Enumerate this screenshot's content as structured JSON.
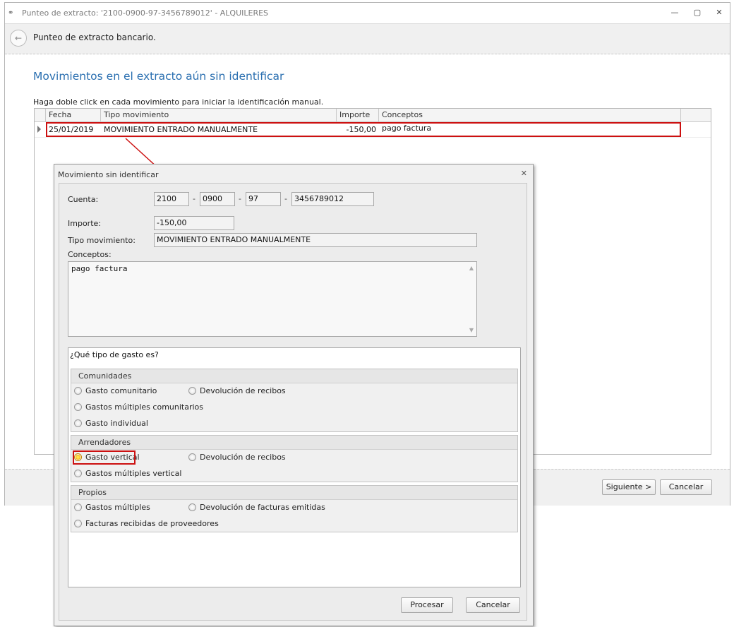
{
  "main_window": {
    "title": "Punteo de extracto: '2100-0900-97-3456789012' - ALQUILERES",
    "title_icon": "link-icon",
    "controls": {
      "minimize": "—",
      "restore": "▢",
      "close": "✕"
    },
    "header_title": "Punteo de extracto bancario.",
    "back_icon": "back-arrow-icon",
    "section_title": "Movimientos en el extracto aún sin identificar",
    "instruction": "Haga doble click en cada movimiento para iniciar la identificación manual.",
    "grid": {
      "columns": [
        "Fecha",
        "Tipo movimiento",
        "Importe",
        "Conceptos"
      ],
      "rows": [
        {
          "fecha": "25/01/2019",
          "tipo": "MOVIMIENTO ENTRADO MANUALMENTE",
          "importe": "-150,00",
          "conceptos": "pago factura"
        }
      ]
    },
    "buttons": {
      "next": "Siguiente >",
      "cancel": "Cancelar"
    }
  },
  "dialog": {
    "title": "Movimiento sin identificar",
    "close": "✕",
    "cuenta_label": "Cuenta:",
    "cuenta": [
      "2100",
      "0900",
      "97",
      "3456789012"
    ],
    "dash": "-",
    "importe_label": "Importe:",
    "importe": "-150,00",
    "tipo_label": "Tipo movimiento:",
    "tipo": "MOVIMIENTO ENTRADO MANUALMENTE",
    "conceptos_label": "Conceptos:",
    "conceptos": "pago factura",
    "question": "¿Qué tipo de gasto es?",
    "groups": [
      {
        "title": "Comunidades",
        "options": [
          "Gasto comunitario",
          "Devolución de recibos",
          "Gastos múltiples comunitarios",
          "Gasto individual"
        ]
      },
      {
        "title": "Arrendadores",
        "options": [
          "Gasto vertical",
          "Devolución de recibos",
          "Gastos múltiples vertical"
        ],
        "selected": "Gasto vertical"
      },
      {
        "title": "Propios",
        "options": [
          "Gastos múltiples",
          "Devolución de facturas emitidas",
          "Facturas recibidas de proveedores"
        ]
      }
    ],
    "buttons": {
      "process": "Procesar",
      "cancel": "Cancelar"
    },
    "highlight_color": "#cc1010"
  }
}
